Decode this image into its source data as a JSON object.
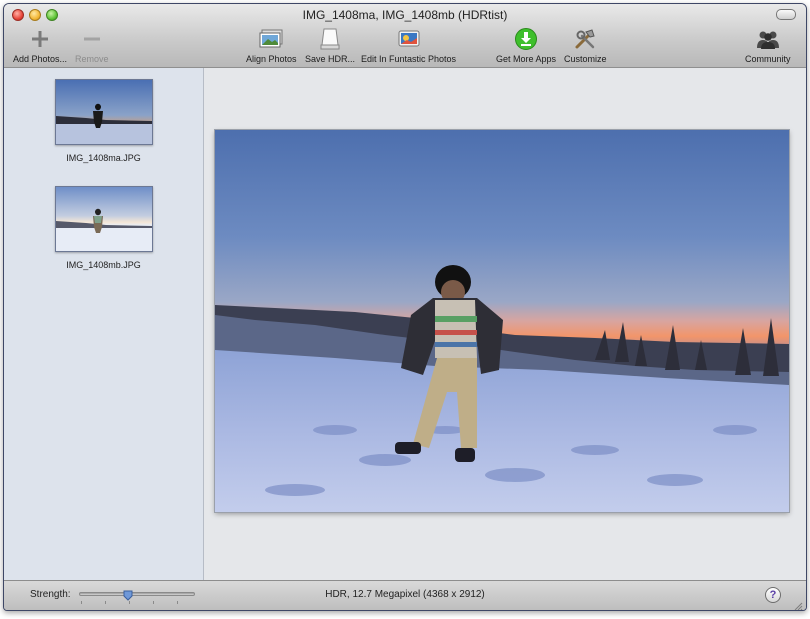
{
  "window": {
    "title": "IMG_1408ma, IMG_1408mb (HDRtist)"
  },
  "toolbar": {
    "add_photos": "Add Photos...",
    "remove": "Remove",
    "align_photos": "Align Photos",
    "save_hdr": "Save HDR...",
    "edit_in": "Edit In Funtastic Photos",
    "get_more_apps": "Get More Apps",
    "customize": "Customize",
    "community": "Community"
  },
  "sidebar": {
    "photos": [
      {
        "filename": "IMG_1408ma.JPG"
      },
      {
        "filename": "IMG_1408mb.JPG"
      }
    ]
  },
  "bottom": {
    "strength_label": "Strength:",
    "strength_value": 0.42,
    "status": "HDR, 12.7 Megapixel (4368 x 2912)",
    "help": "?"
  },
  "colors": {
    "accent_green": "#3fbf2c",
    "window_border": "#3e4766",
    "sidebar_bg": "#dde3ec"
  }
}
